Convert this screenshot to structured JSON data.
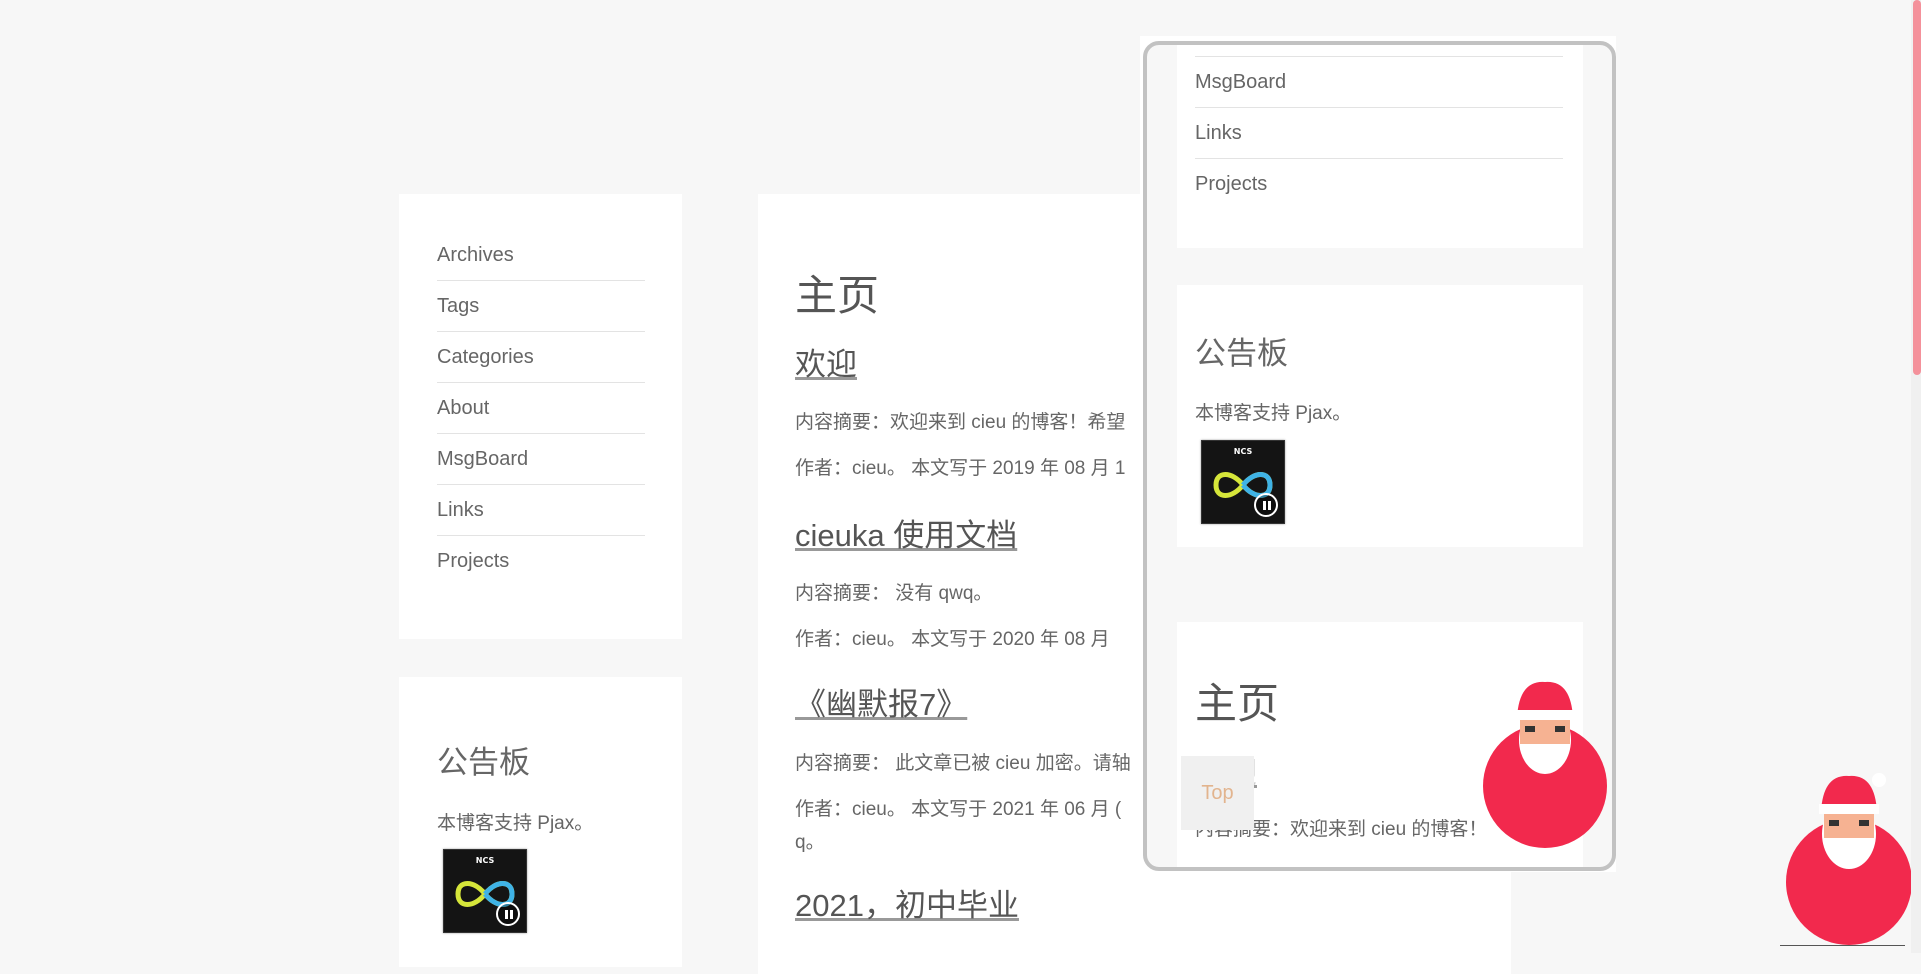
{
  "sidebar": {
    "nav_items": [
      "Archives",
      "Tags",
      "Categories",
      "About",
      "MsgBoard",
      "Links",
      "Projects"
    ],
    "notice_title": "公告板",
    "notice_text": "本博客支持 Pjax。",
    "album_brand": "NCS"
  },
  "main": {
    "page_title": "主页",
    "posts": [
      {
        "title": "欢迎",
        "summary": "内容摘要：欢迎来到 cieu 的博客！希望",
        "meta": "作者：cieu。 本文写于 2019 年 08 月 1"
      },
      {
        "title": "cieuka 使用文档",
        "summary": "内容摘要：  没有 qwq。",
        "meta": "作者：cieu。 本文写于 2020 年 08 月"
      },
      {
        "title": "《幽默报7》",
        "summary": "内容摘要：  此文章已被 cieu 加密。请轴",
        "meta": "作者：cieu。 本文写于 2021 年 06 月 (",
        "meta_wrap": "q。"
      },
      {
        "title": "2021，初中毕业"
      }
    ]
  },
  "preview": {
    "nav_items": [
      "MsgBoard",
      "Links",
      "Projects"
    ],
    "notice_title": "公告板",
    "notice_text": "本博客支持 Pjax。",
    "page_title": "主页",
    "partial_title": "欢迎",
    "summary": "内容摘要：欢迎来到 cieu 的博客！",
    "top_button": "Top"
  },
  "colors": {
    "santa_red": "#f2294d",
    "scroll_thumb": "#f4919b",
    "top_text": "#e2b48e"
  }
}
